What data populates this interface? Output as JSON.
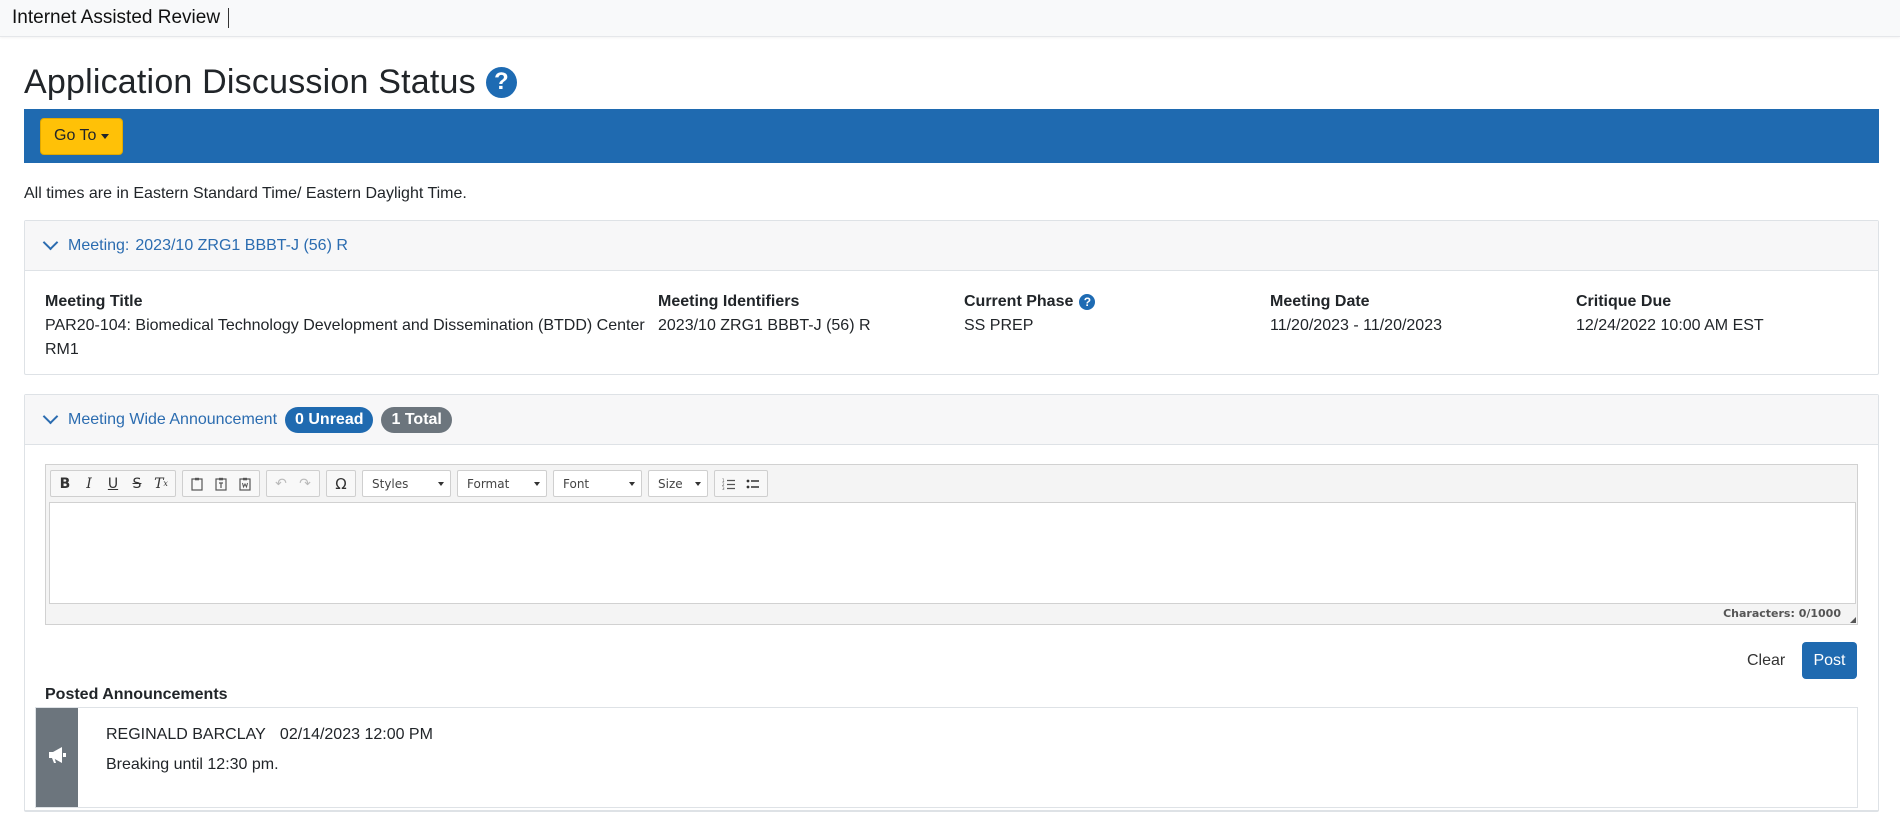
{
  "app": {
    "title": "Internet Assisted Review"
  },
  "page": {
    "title": "Application Discussion Status",
    "help_icon": "question-circle-icon"
  },
  "nav": {
    "goto_label": "Go To"
  },
  "timezone_note": "All times are in Eastern Standard Time/ Eastern Daylight Time.",
  "meeting": {
    "header_label": "Meeting:",
    "header_value": "2023/10 ZRG1 BBBT-J (56) R",
    "title_label": "Meeting Title",
    "title_value_line1": "PAR20-104: Biomedical Technology Development and Dissemination (BTDD) Center",
    "title_value_line2": "RM1",
    "identifiers_label": "Meeting Identifiers",
    "identifiers_value": "2023/10 ZRG1 BBBT-J (56) R",
    "phase_label": "Current Phase",
    "phase_value": "SS PREP",
    "date_label": "Meeting Date",
    "date_value": "11/20/2023 - 11/20/2023",
    "critique_label": "Critique Due",
    "critique_value": "12/24/2022 10:00 AM EST"
  },
  "announcement": {
    "header_label": "Meeting Wide Announcement",
    "unread_badge": "0 Unread",
    "total_badge": "1 Total",
    "editor": {
      "toolbar_dropdowns": {
        "styles": "Styles",
        "format": "Format",
        "font": "Font",
        "size": "Size"
      },
      "char_count": "Characters: 0/1000"
    },
    "clear_label": "Clear",
    "post_label": "Post",
    "posted_title": "Posted Announcements",
    "posts": [
      {
        "author": "REGINALD BARCLAY",
        "date": "02/14/2023 12:00 PM",
        "message": "Breaking until 12:30 pm."
      }
    ]
  },
  "colors": {
    "brand_blue": "#1f6ab0",
    "goto_yellow": "#ffc107",
    "badge_gray": "#6c757d"
  }
}
